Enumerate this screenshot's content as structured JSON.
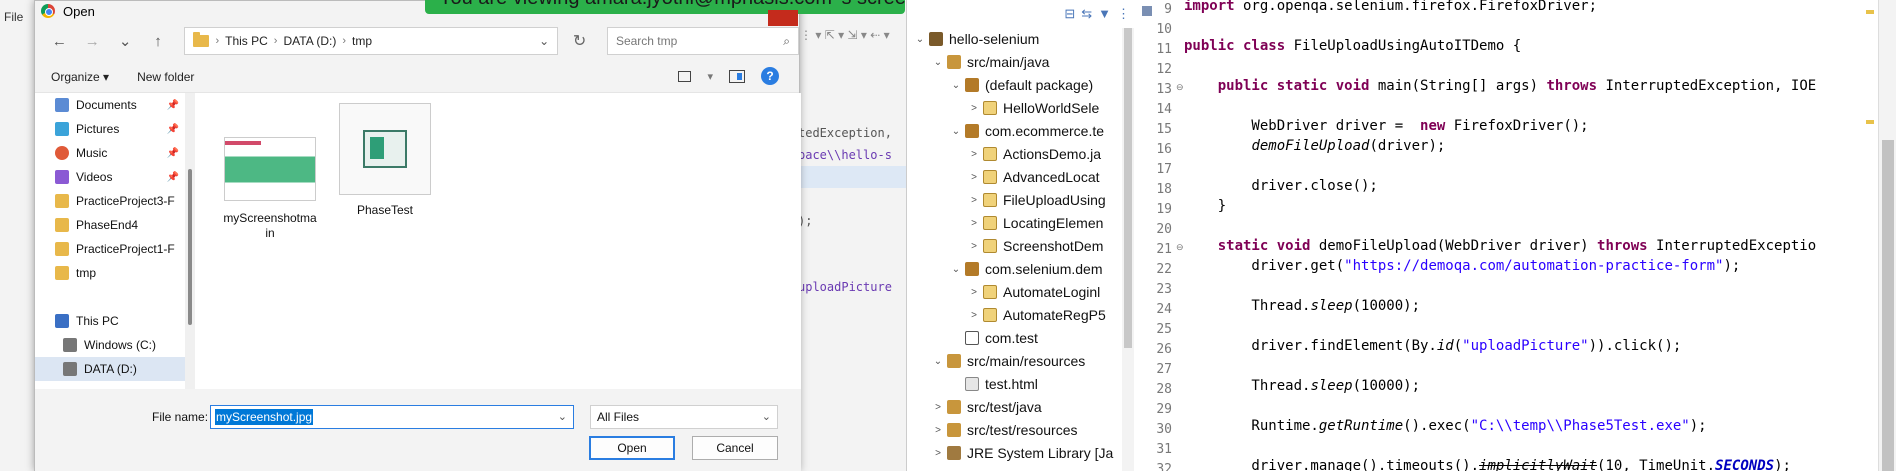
{
  "banner": {
    "text": "You are viewing amara.jyothi@mphasis.com 's screen"
  },
  "background_ide": {
    "menu_hint": "File",
    "code_lines": [
      "tedException,",
      "pace\\\\hello-s",
      "",
      "",
      "",
      "",
      ");",
      "",
      "",
      "uploadPicture",
      "",
      "",
      "",
      "",
      "",
      "",
      ""
    ]
  },
  "dialog": {
    "title": "Open",
    "nav": {
      "back": "←",
      "forward": "→",
      "recent": "⌄",
      "up": "↑"
    },
    "breadcrumb": [
      "This PC",
      "DATA (D:)",
      "tmp"
    ],
    "search_placeholder": "Search tmp",
    "commands": {
      "organize": "Organize ▾",
      "new_folder": "New folder"
    },
    "nav_items": [
      {
        "label": "Documents",
        "icon": "documents-icon",
        "pinned": true
      },
      {
        "label": "Pictures",
        "icon": "pictures-icon",
        "pinned": true
      },
      {
        "label": "Music",
        "icon": "music-icon",
        "pinned": true
      },
      {
        "label": "Videos",
        "icon": "videos-icon",
        "pinned": true
      },
      {
        "label": "PracticeProject3-F",
        "icon": "folder-icon",
        "pinned": false
      },
      {
        "label": "PhaseEnd4",
        "icon": "folder-icon",
        "pinned": false
      },
      {
        "label": "PracticeProject1-F",
        "icon": "folder-icon",
        "pinned": false
      },
      {
        "label": "tmp",
        "icon": "folder-icon",
        "pinned": false
      },
      {
        "label": "",
        "icon": "",
        "pinned": false
      },
      {
        "label": "This PC",
        "icon": "pc-icon",
        "pinned": false
      },
      {
        "label": "Windows (C:)",
        "icon": "drive-icon",
        "pinned": false
      },
      {
        "label": "DATA (D:)",
        "icon": "drive-icon",
        "pinned": false
      }
    ],
    "files": [
      {
        "name": "myScreenshotma\nin"
      },
      {
        "name": "PhaseTest"
      }
    ],
    "file_name_label": "File name:",
    "file_name_value": "myScreenshot.jpg",
    "file_type": "All Files",
    "open_button": "Open",
    "cancel_button": "Cancel"
  },
  "explorer": {
    "items": [
      {
        "label": "hello-selenium",
        "indent": 0,
        "twisty": "⌄",
        "icon": "project"
      },
      {
        "label": "src/main/java",
        "indent": 1,
        "twisty": "⌄",
        "icon": "src"
      },
      {
        "label": "(default package)",
        "indent": 2,
        "twisty": "⌄",
        "icon": "pkg"
      },
      {
        "label": "HelloWorldSele",
        "indent": 3,
        "twisty": ">",
        "icon": "java"
      },
      {
        "label": "com.ecommerce.te",
        "indent": 2,
        "twisty": "⌄",
        "icon": "pkg"
      },
      {
        "label": "ActionsDemo.ja",
        "indent": 3,
        "twisty": ">",
        "icon": "java"
      },
      {
        "label": "AdvancedLocat",
        "indent": 3,
        "twisty": ">",
        "icon": "java"
      },
      {
        "label": "FileUploadUsing",
        "indent": 3,
        "twisty": ">",
        "icon": "java"
      },
      {
        "label": "LocatingElemen",
        "indent": 3,
        "twisty": ">",
        "icon": "java"
      },
      {
        "label": "ScreenshotDem",
        "indent": 3,
        "twisty": ">",
        "icon": "java"
      },
      {
        "label": "com.selenium.dem",
        "indent": 2,
        "twisty": "⌄",
        "icon": "pkg"
      },
      {
        "label": "AutomateLoginl",
        "indent": 3,
        "twisty": ">",
        "icon": "java"
      },
      {
        "label": "AutomateRegP5",
        "indent": 3,
        "twisty": ">",
        "icon": "java"
      },
      {
        "label": "com.test",
        "indent": 2,
        "twisty": "",
        "icon": "empty"
      },
      {
        "label": "src/main/resources",
        "indent": 1,
        "twisty": "⌄",
        "icon": "src"
      },
      {
        "label": "test.html",
        "indent": 2,
        "twisty": "",
        "icon": "file"
      },
      {
        "label": "src/test/java",
        "indent": 1,
        "twisty": ">",
        "icon": "src"
      },
      {
        "label": "src/test/resources",
        "indent": 1,
        "twisty": ">",
        "icon": "src"
      },
      {
        "label": "JRE System Library [Ja",
        "indent": 1,
        "twisty": ">",
        "icon": "lib"
      }
    ]
  },
  "editor": {
    "line_numbers": [
      "9",
      "10",
      "11",
      "12",
      "13",
      "14",
      "15",
      "16",
      "17",
      "18",
      "19",
      "20",
      "21",
      "22",
      "23",
      "24",
      "25",
      "26",
      "27",
      "28",
      "29",
      "30",
      "31",
      "32"
    ]
  }
}
